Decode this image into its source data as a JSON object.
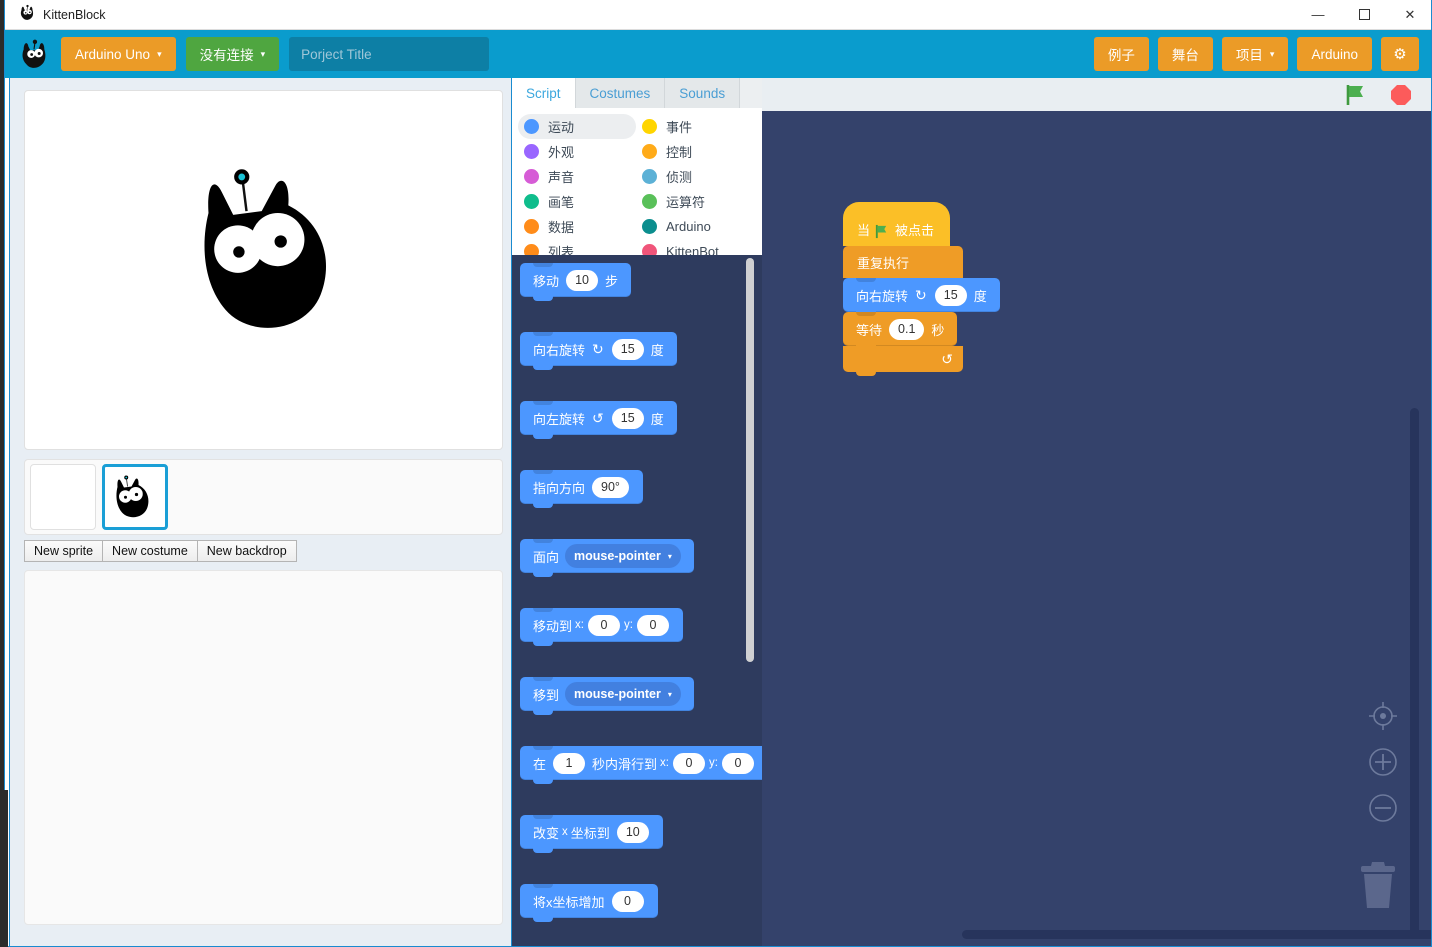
{
  "window": {
    "title": "KittenBlock",
    "controls": {
      "minimize": "—",
      "maximize": "☐",
      "close": "✕"
    }
  },
  "header": {
    "board_button": "Arduino Uno",
    "connect_button": "没有连接",
    "project_title_value": "",
    "project_title_placeholder": "Porject Title",
    "caret": "▾",
    "right_buttons": [
      {
        "label": "例子",
        "name": "examples-button",
        "caret": false
      },
      {
        "label": "舞台",
        "name": "stage-button",
        "caret": false
      },
      {
        "label": "项目",
        "name": "project-menu-button",
        "caret": true
      },
      {
        "label": "Arduino",
        "name": "arduino-button",
        "caret": false
      }
    ],
    "settings_icon": "⚙",
    "colors": {
      "bar": "#0a9ccd",
      "orange": "#eb9b27",
      "green": "#4fa640",
      "input": "#0d7fa5"
    }
  },
  "tabs": [
    {
      "label": "Script",
      "active": true
    },
    {
      "label": "Costumes",
      "active": false
    },
    {
      "label": "Sounds",
      "active": false
    }
  ],
  "categories": {
    "left": [
      {
        "label": "运动",
        "color": "#4c97ff",
        "selected": true
      },
      {
        "label": "外观",
        "color": "#9966ff",
        "selected": false
      },
      {
        "label": "声音",
        "color": "#d65cd6",
        "selected": false
      },
      {
        "label": "画笔",
        "color": "#0fbd8c",
        "selected": false
      },
      {
        "label": "数据",
        "color": "#ff8c1a",
        "selected": false
      },
      {
        "label": "列表",
        "color": "#ff8c1a",
        "selected": false
      }
    ],
    "right": [
      {
        "label": "事件",
        "color": "#ffd500",
        "selected": false
      },
      {
        "label": "控制",
        "color": "#ffab19",
        "selected": false
      },
      {
        "label": "侦测",
        "color": "#5cb1d6",
        "selected": false
      },
      {
        "label": "运算符",
        "color": "#59c059",
        "selected": false
      },
      {
        "label": "Arduino",
        "color": "#0b8e8e",
        "selected": false
      },
      {
        "label": "KittenBot",
        "color": "#f0557a",
        "selected": false
      }
    ]
  },
  "palette": {
    "blocks": [
      {
        "name": "move-steps-block",
        "parts": [
          {
            "t": "label",
            "v": "移动"
          },
          {
            "t": "oval",
            "v": "10"
          },
          {
            "t": "label",
            "v": "步"
          }
        ]
      },
      {
        "name": "turn-right-block",
        "parts": [
          {
            "t": "label",
            "v": "向右旋转"
          },
          {
            "t": "icon",
            "v": "↻"
          },
          {
            "t": "oval",
            "v": "15"
          },
          {
            "t": "label",
            "v": "度"
          }
        ]
      },
      {
        "name": "turn-left-block",
        "parts": [
          {
            "t": "label",
            "v": "向左旋转"
          },
          {
            "t": "icon",
            "v": "↺"
          },
          {
            "t": "oval",
            "v": "15"
          },
          {
            "t": "label",
            "v": "度"
          }
        ]
      },
      {
        "name": "point-direction-block",
        "parts": [
          {
            "t": "label",
            "v": "指向方向"
          },
          {
            "t": "oval",
            "v": "90°"
          }
        ]
      },
      {
        "name": "point-towards-block",
        "parts": [
          {
            "t": "label",
            "v": "面向"
          },
          {
            "t": "dropdown",
            "v": "mouse-pointer"
          }
        ]
      },
      {
        "name": "goto-xy-block",
        "parts": [
          {
            "t": "label",
            "v": "移动到"
          },
          {
            "t": "small",
            "v": "x:"
          },
          {
            "t": "oval",
            "v": "0"
          },
          {
            "t": "small",
            "v": "y:"
          },
          {
            "t": "oval",
            "v": "0"
          }
        ]
      },
      {
        "name": "goto-target-block",
        "parts": [
          {
            "t": "label",
            "v": "移到"
          },
          {
            "t": "dropdown",
            "v": "mouse-pointer"
          }
        ]
      },
      {
        "name": "glide-block",
        "parts": [
          {
            "t": "label",
            "v": "在"
          },
          {
            "t": "oval",
            "v": "1"
          },
          {
            "t": "label",
            "v": "秒内滑行到"
          },
          {
            "t": "small",
            "v": "x:"
          },
          {
            "t": "oval",
            "v": "0"
          },
          {
            "t": "small",
            "v": "y:"
          },
          {
            "t": "oval",
            "v": "0"
          }
        ]
      },
      {
        "name": "set-x-block",
        "parts": [
          {
            "t": "label",
            "v": "改变"
          },
          {
            "t": "small",
            "v": "x"
          },
          {
            "t": "label",
            "v": "坐标到"
          },
          {
            "t": "oval",
            "v": "10"
          }
        ]
      },
      {
        "name": "change-x-block",
        "parts": [
          {
            "t": "label",
            "v": "将x坐标增加"
          },
          {
            "t": "oval",
            "v": "0"
          }
        ]
      }
    ]
  },
  "workspace": {
    "green_flag_icon": "green-flag-icon",
    "stop_icon": "stop-octagon-icon",
    "script": {
      "hat_label_before": "当",
      "hat_label_after": "被点击",
      "repeat_label": "重复执行",
      "loop_arrow": "↺",
      "inner_blocks": [
        {
          "name": "turn-right-block",
          "parts": [
            {
              "t": "label",
              "v": "向右旋转"
            },
            {
              "t": "icon",
              "v": "↻"
            },
            {
              "t": "oval",
              "v": "15"
            },
            {
              "t": "label",
              "v": "度"
            }
          ],
          "cls": "motion"
        },
        {
          "name": "wait-seconds-block",
          "parts": [
            {
              "t": "label",
              "v": "等待"
            },
            {
              "t": "oval",
              "v": "0.1"
            },
            {
              "t": "label",
              "v": "秒"
            }
          ],
          "cls": "control"
        }
      ]
    },
    "controls": {
      "center": "crosshair-icon",
      "zoom_in": "plus-icon",
      "zoom_out": "minus-icon",
      "trash": "trash-icon"
    },
    "colors": {
      "background": "#34426b",
      "palette_background": "#2e3b5e"
    }
  },
  "sprites": {
    "new_buttons": [
      "New sprite",
      "New costume",
      "New backdrop"
    ],
    "tiles": [
      {
        "name": "sprite-tile-empty",
        "selected": false,
        "has_image": false
      },
      {
        "name": "sprite-tile-kitten",
        "selected": true,
        "has_image": true
      }
    ]
  }
}
